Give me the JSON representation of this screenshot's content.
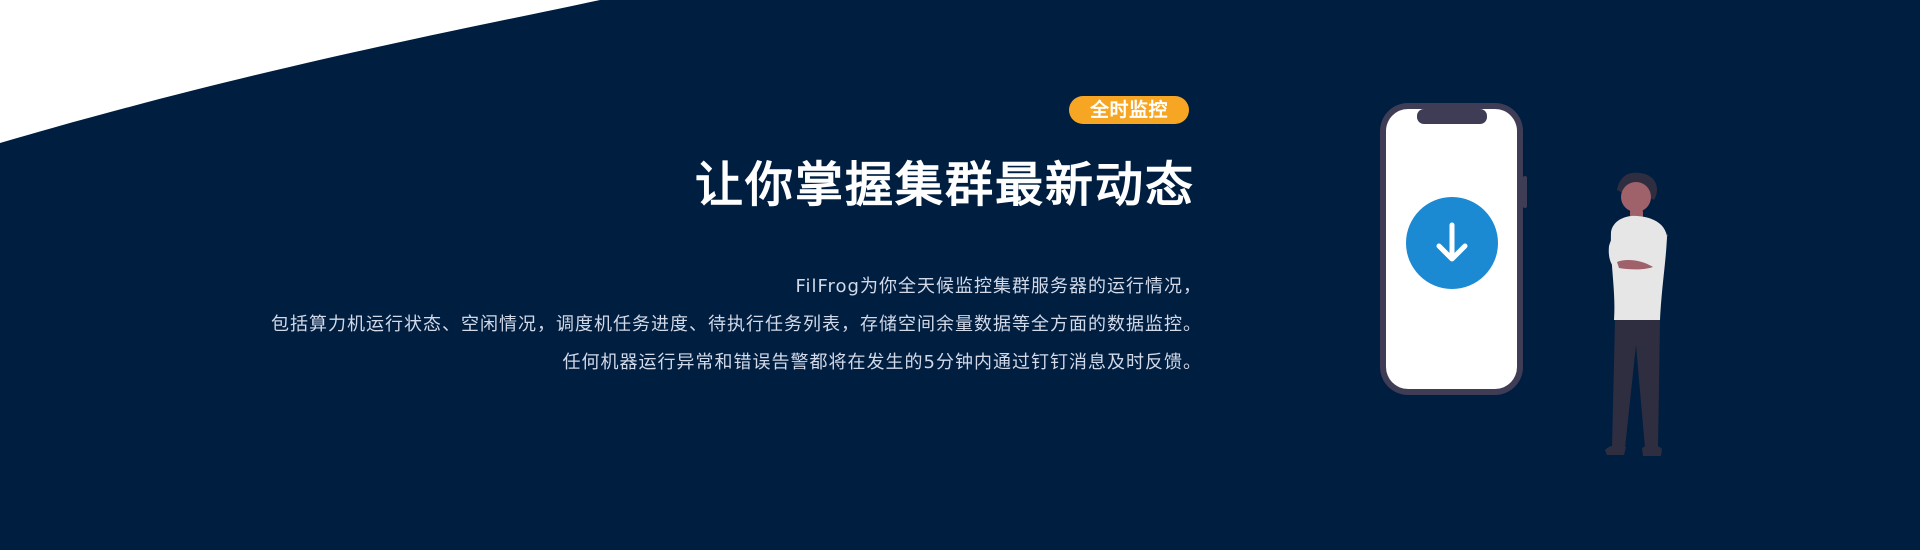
{
  "banner": {
    "badge": "全时监控",
    "title": "让你掌握集群最新动态",
    "description": [
      "FilFrog为你全天候监控集群服务器的运行情况，",
      "包括算力机运行状态、空闲情况，调度机任务进度、待执行任务列表，存储空间余量数据等全方面的数据监控。",
      "任何机器运行异常和错误告警都将在发生的5分钟内通过钉钉消息及时反馈。"
    ]
  },
  "colors": {
    "background": "#001e40",
    "badge": "#f6a623",
    "download_button": "#1b8ad3",
    "title": "#ffffff",
    "description": "#d2d9e8"
  },
  "illustration": {
    "phone_button_icon": "download-arrow-icon",
    "figure": "person-standing"
  }
}
